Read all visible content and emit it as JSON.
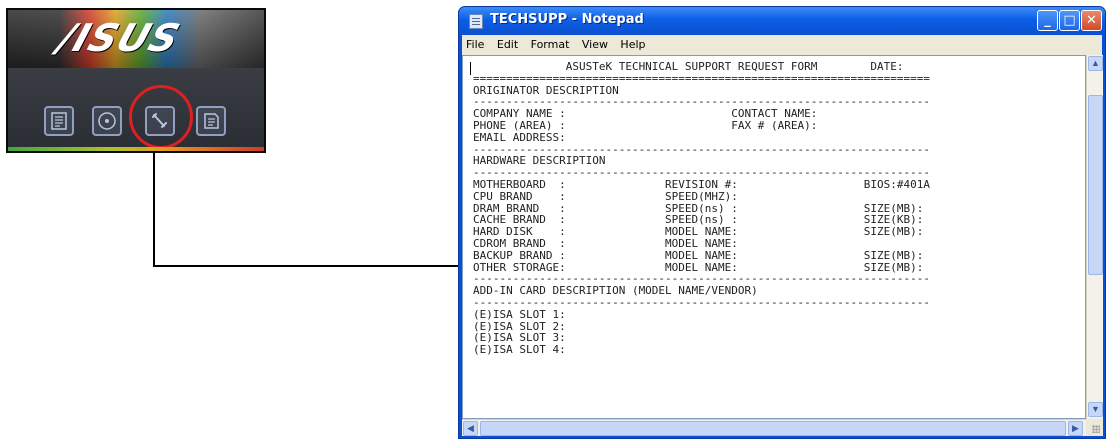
{
  "launcher": {
    "logo_text": "/ISUS",
    "icons": [
      "drivers-icon",
      "disc-icon",
      "wrench-icon",
      "document-icon"
    ],
    "highlighted_icon": "wrench-icon"
  },
  "window": {
    "title": "TECHSUPP - Notepad",
    "buttons": {
      "minimize": "_",
      "maximize": "□",
      "close": "✕"
    }
  },
  "menu": [
    "File",
    "Edit",
    "Format",
    "View",
    "Help"
  ],
  "document": {
    "lines": [
      "              ASUSTeK TECHNICAL SUPPORT REQUEST FORM        DATE:",
      "=====================================================================",
      "ORIGINATOR DESCRIPTION",
      "---------------------------------------------------------------------",
      "COMPANY NAME :                         CONTACT NAME:",
      "PHONE (AREA) :                         FAX # (AREA):",
      "EMAIL ADDRESS:",
      "---------------------------------------------------------------------",
      "HARDWARE DESCRIPTION",
      "---------------------------------------------------------------------",
      "MOTHERBOARD  :               REVISION #:                   BIOS:#401A",
      "CPU BRAND    :               SPEED(MHZ):",
      "DRAM BRAND   :               SPEED(ns) :                   SIZE(MB):",
      "CACHE BRAND  :               SPEED(ns) :                   SIZE(KB):",
      "HARD DISK    :               MODEL NAME:                   SIZE(MB):",
      "CDROM BRAND  :               MODEL NAME:",
      "BACKUP BRAND :               MODEL NAME:                   SIZE(MB):",
      "OTHER STORAGE:               MODEL NAME:                   SIZE(MB):",
      "---------------------------------------------------------------------",
      "ADD-IN CARD DESCRIPTION (MODEL NAME/VENDOR)",
      "---------------------------------------------------------------------",
      "(E)ISA SLOT 1:",
      "(E)ISA SLOT 2:",
      "(E)ISA SLOT 3:",
      "(E)ISA SLOT 4:"
    ]
  },
  "colors": {
    "titlebar": "#0c5fe6",
    "callout": "#e02020",
    "menubar": "#ece9d8"
  }
}
